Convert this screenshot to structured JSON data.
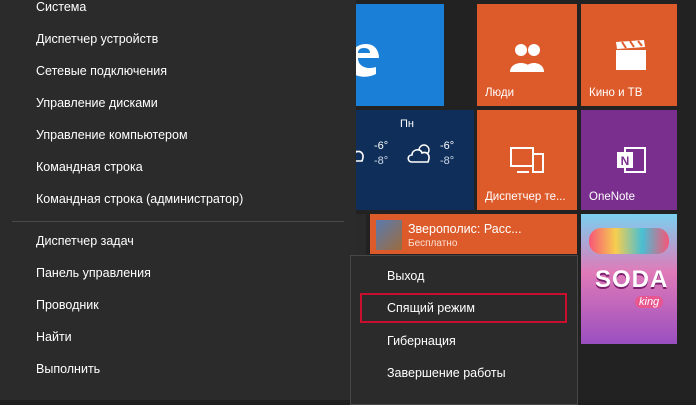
{
  "menu": {
    "items": [
      {
        "label": "Система"
      },
      {
        "label": "Диспетчер устройств"
      },
      {
        "label": "Сетевые подключения"
      },
      {
        "label": "Управление дисками"
      },
      {
        "label": "Управление компьютером"
      },
      {
        "label": "Командная строка"
      },
      {
        "label": "Командная строка (администратор)"
      },
      {
        "label": "Диспетчер задач"
      },
      {
        "label": "Панель управления"
      },
      {
        "label": "Проводник"
      },
      {
        "label": "Найти"
      },
      {
        "label": "Выполнить"
      }
    ]
  },
  "submenu": {
    "items": [
      {
        "label": "Выход"
      },
      {
        "label": "Спящий режим"
      },
      {
        "label": "Гибернация"
      },
      {
        "label": "Завершение работы"
      }
    ],
    "highlight_color": "#c8102e"
  },
  "tiles": {
    "people": {
      "label": "Люди"
    },
    "movies": {
      "label": "Кино и ТВ"
    },
    "weather": {
      "day": "Пн",
      "temp1": "-6°",
      "temp1_low": "-8°",
      "temp2": "-6°",
      "temp2_low": "-8°"
    },
    "device_manager": {
      "label": "Диспетчер те..."
    },
    "onenote": {
      "label": "OneNote"
    },
    "zootopia": {
      "title": "Зверополис: Расс...",
      "subtitle": "Бесплатно"
    },
    "candy": {
      "text": "SODA",
      "badge": "king"
    }
  },
  "colors": {
    "tile_orange": "#dd5b2b",
    "tile_blue": "#1a7fd6",
    "tile_purple": "#7a2e8e",
    "menu_bg": "#2b2b2b"
  }
}
